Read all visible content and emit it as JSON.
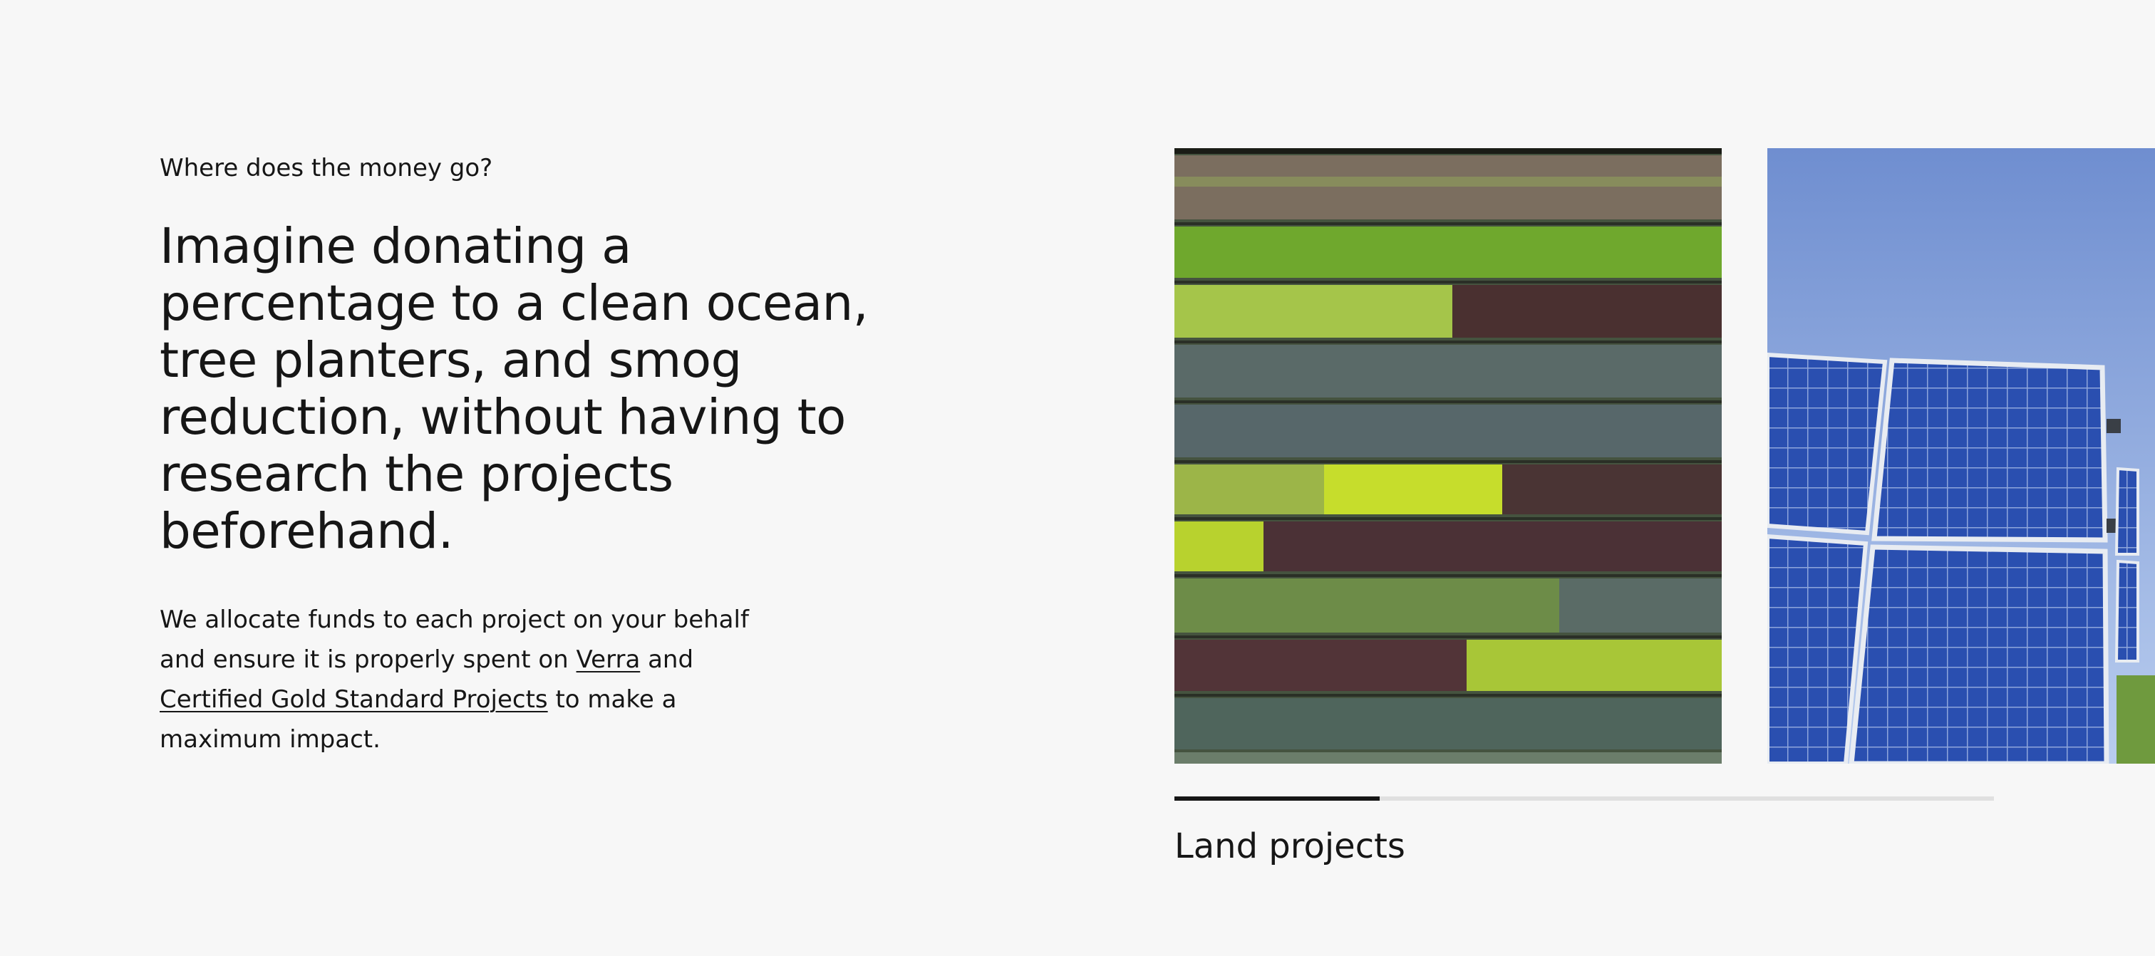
{
  "section": {
    "eyebrow": "Where does the money go?",
    "headline": "Imagine donating a percentage to a clean ocean, tree planters, and smog reduction, without having to research the projects beforehand.",
    "body_before": "We allocate funds to each project on your behalf and ensure it is properly spent on ",
    "link_verra": "Verra",
    "body_between": " and ",
    "link_gold": "Certified Gold Standard Projects",
    "body_after": " to make a maximum impact."
  },
  "carousel": {
    "active_caption": "Land projects",
    "progress_fraction": 0.25,
    "slides": [
      {
        "image": "aerial-crop-rows-image"
      },
      {
        "image": "solar-panels-image"
      }
    ]
  }
}
